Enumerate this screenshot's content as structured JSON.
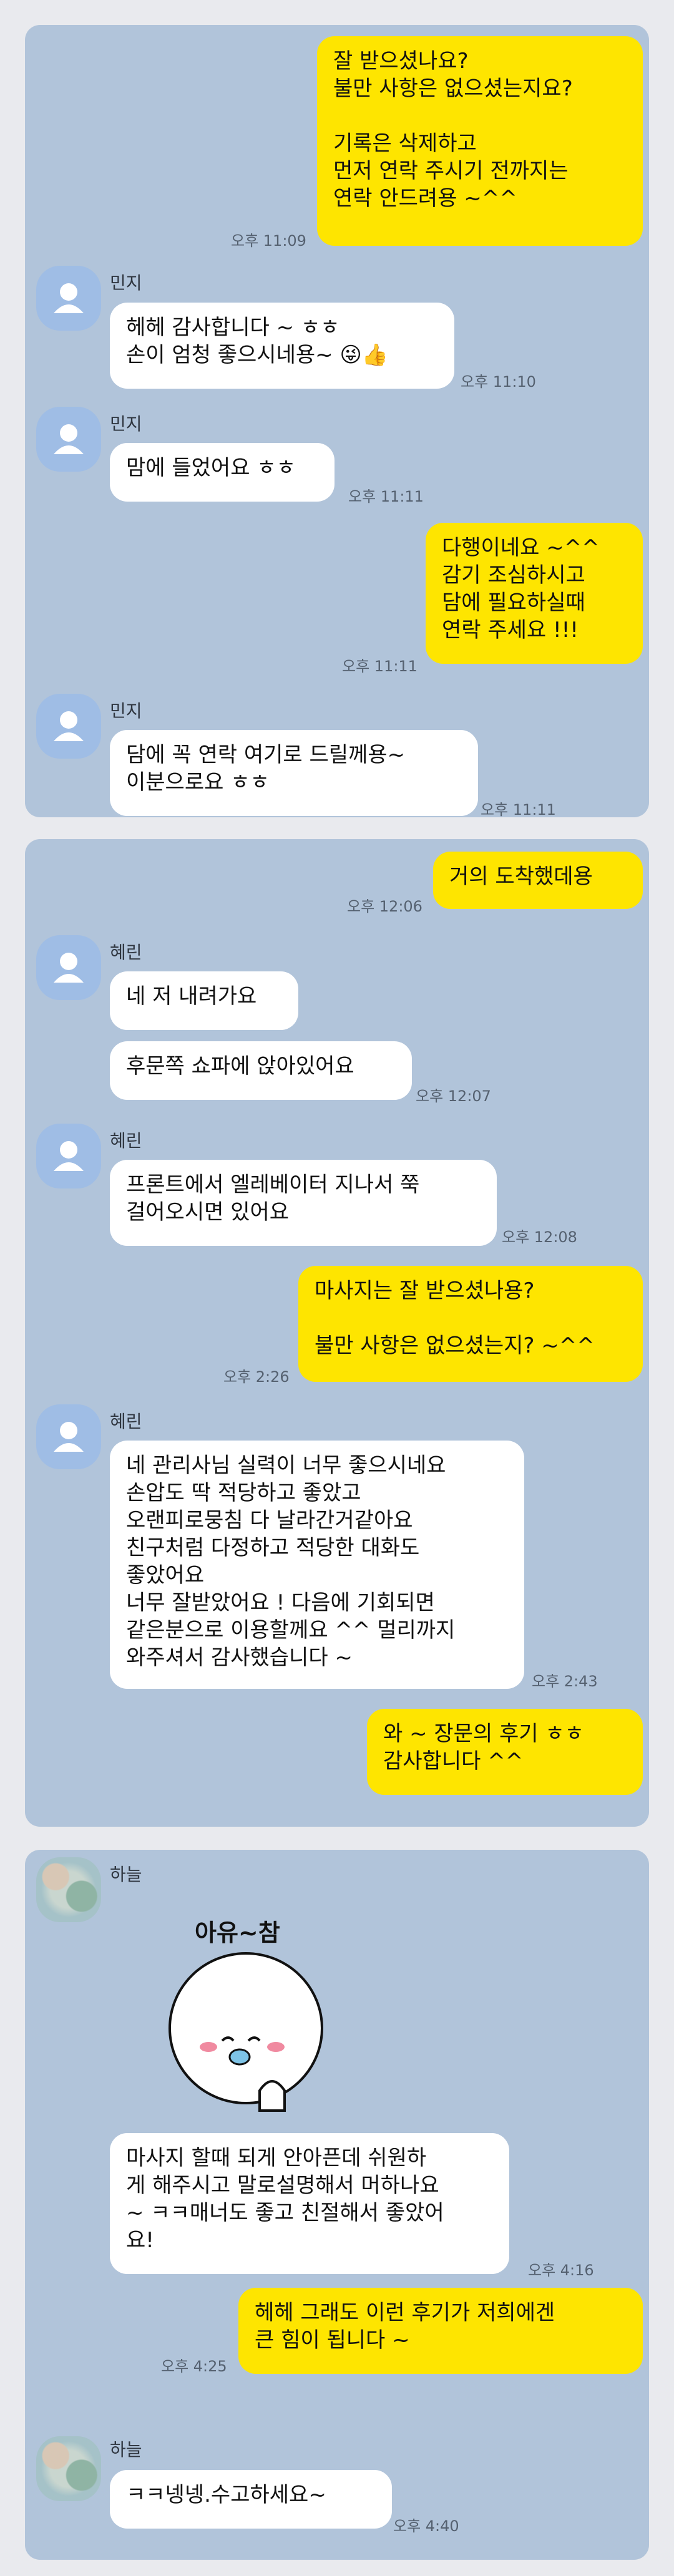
{
  "panels": [
    {
      "messages": [
        {
          "from": "me",
          "text": "잘 받으셨나요?\n불만 사항은 없으셨는지요?\n\n기록은 삭제하고\n먼저 연락 주시기 전까지는\n연락 안드려용 ~^^",
          "time": "오후 11:09"
        },
        {
          "from": "them",
          "sender": "민지",
          "text": "헤헤 감사합니다 ~ ㅎㅎ\n손이 엄청 좋으시네용~ 😜👍",
          "time": "오후 11:10"
        },
        {
          "from": "them",
          "sender": "민지",
          "text": "맘에 들었어요 ㅎㅎ",
          "time": "오후 11:11"
        },
        {
          "from": "me",
          "text": "다행이네요 ~^^\n감기 조심하시고\n담에 필요하실때\n연락 주세요 !!!",
          "time": "오후 11:11"
        },
        {
          "from": "them",
          "sender": "민지",
          "text": "담에 꼭 연락 여기로 드릴께용~\n이분으로요 ㅎㅎ",
          "time": "오후 11:11"
        }
      ]
    },
    {
      "messages": [
        {
          "from": "me",
          "text": "거의 도착했데용",
          "time": "오후 12:06"
        },
        {
          "from": "them",
          "sender": "혜린",
          "text": "네 저 내려가요",
          "time": ""
        },
        {
          "from": "them",
          "sender": "",
          "text": "후문쪽 쇼파에 앉아있어요",
          "time": "오후 12:07"
        },
        {
          "from": "them",
          "sender": "혜린",
          "text": "프론트에서 엘레베이터 지나서 쭉\n걸어오시면 있어요",
          "time": "오후 12:08"
        },
        {
          "from": "me",
          "text": "마사지는 잘 받으셨나용?\n\n불만 사항은 없으셨는지? ~^^",
          "time": "오후 2:26"
        },
        {
          "from": "them",
          "sender": "혜린",
          "text": "네 관리사님 실력이 너무 좋으시네요\n손압도 딱 적당하고 좋았고\n오랜피로뭉침 다 날라간거같아요\n친구처럼 다정하고 적당한 대화도\n좋았어요\n너무 잘받았어요 ! 다음에 기회되면\n같은분으로 이용할께요 ^^ 멀리까지\n와주셔서 감사했습니다 ~",
          "time": "오후 2:43"
        },
        {
          "from": "me",
          "text": "와 ~ 장문의 후기 ㅎㅎ\n감사합니다 ^^",
          "time": ""
        }
      ]
    },
    {
      "messages": [
        {
          "from": "them",
          "sender": "하늘",
          "sticker_text": "아유~참",
          "text": "마사지 할때 되게 안아픈데 쉬원하\n게 해주시고 말로설명해서 머하나요\n~ ㅋㅋ매너도 좋고 친절해서 좋았어\n요!",
          "time": "오후 4:16"
        },
        {
          "from": "me",
          "text": "헤헤 그래도 이런 후기가 저희에겐\n큰 힘이 됩니다 ~",
          "time": "오후 4:25"
        },
        {
          "from": "them",
          "sender": "하늘",
          "text": "ㅋㅋ넹넹.수고하세요~",
          "time": "오후 4:40"
        }
      ]
    }
  ]
}
